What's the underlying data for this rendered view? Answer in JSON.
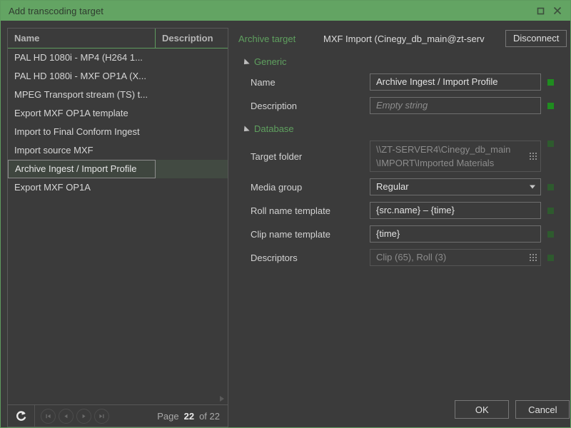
{
  "window": {
    "title": "Add transcoding target",
    "maximize_icon": "maximize-icon",
    "close_icon": "close-icon"
  },
  "list": {
    "columns": [
      "Name",
      "Description"
    ],
    "rows": [
      {
        "name": "PAL HD 1080i - MP4 (H264 1...",
        "description": "",
        "selected": false
      },
      {
        "name": "PAL HD 1080i - MXF OP1A (X...",
        "description": "",
        "selected": false
      },
      {
        "name": "MPEG Transport stream (TS) t...",
        "description": "",
        "selected": false
      },
      {
        "name": "Export MXF OP1A template",
        "description": "",
        "selected": false
      },
      {
        "name": "Import to Final Conform Ingest",
        "description": "",
        "selected": false
      },
      {
        "name": "Import source MXF",
        "description": "",
        "selected": false
      },
      {
        "name": "Archive Ingest / Import Profile",
        "description": "",
        "selected": true
      },
      {
        "name": "Export MXF OP1A",
        "description": "",
        "selected": false
      }
    ]
  },
  "pager": {
    "refresh_icon": "refresh-icon",
    "first_icon": "first-page-icon",
    "prev_icon": "previous-page-icon",
    "next_icon": "next-page-icon",
    "last_icon": "last-page-icon",
    "page_label": "Page",
    "page_number": "22",
    "of_label": "of 22"
  },
  "details": {
    "target_label": "Archive target",
    "target_value": "MXF Import (Cinegy_db_main@zt-serv",
    "disconnect_label": "Disconnect",
    "sections": [
      {
        "title": "Generic"
      },
      {
        "title": "Database"
      }
    ],
    "fields": {
      "name": {
        "label": "Name",
        "value": "Archive Ingest / Import Profile"
      },
      "description": {
        "label": "Description",
        "placeholder": "Empty string"
      },
      "target_folder": {
        "label": "Target folder",
        "value": "\\\\ZT-SERVER4\\Cinegy_db_main \\IMPORT\\Imported Materials"
      },
      "media_group": {
        "label": "Media group",
        "value": "Regular"
      },
      "roll_name_template": {
        "label": "Roll name template",
        "value": "{src.name} – {time}"
      },
      "clip_name_template": {
        "label": "Clip name template",
        "value": "{time}"
      },
      "descriptors": {
        "label": "Descriptors",
        "value": "Clip (65), Roll (3)"
      }
    }
  },
  "footer": {
    "ok_label": "OK",
    "cancel_label": "Cancel"
  },
  "colors": {
    "titlebar": "#63a463",
    "accent_green": "#5fa05f",
    "indicator_on": "#1f8c1f",
    "indicator_dim": "#2e5a2e",
    "window_bg": "#3b3b3b"
  }
}
